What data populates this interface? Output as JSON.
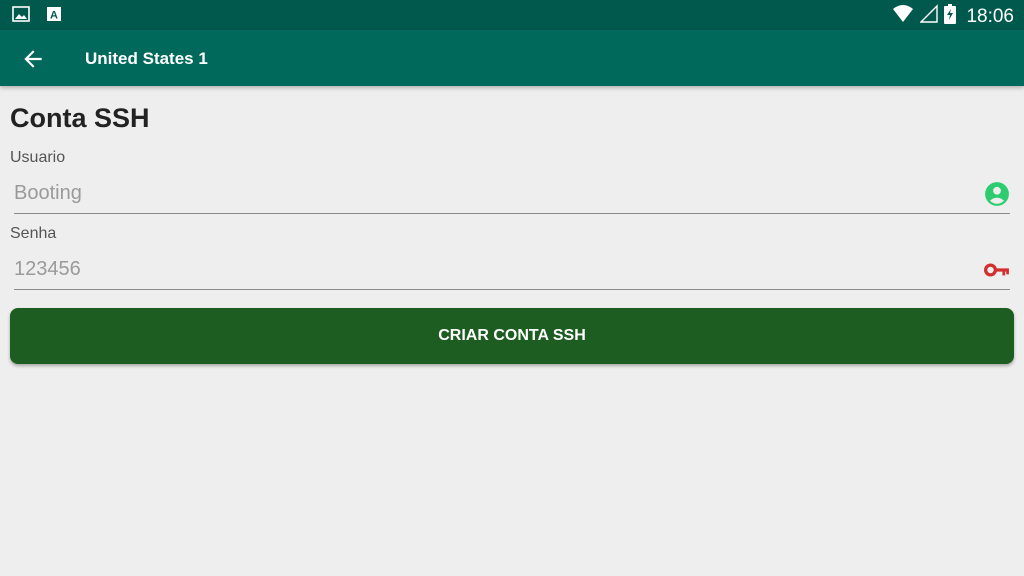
{
  "status_bar": {
    "time": "18:06",
    "left_icons": [
      "image-icon",
      "a-letter-icon"
    ],
    "right_icons": [
      "wifi-icon",
      "cell-signal-icon",
      "battery-charging-icon"
    ]
  },
  "toolbar": {
    "title": "United States 1",
    "back_icon": "arrow-left-icon",
    "color": "#00695c"
  },
  "page": {
    "title": "Conta SSH"
  },
  "form": {
    "username": {
      "label": "Usuario",
      "placeholder": "Booting",
      "value": "",
      "icon": "account-circle-icon",
      "icon_color": "#2ecc71"
    },
    "password": {
      "label": "Senha",
      "placeholder": "123456",
      "value": "",
      "icon": "key-icon",
      "icon_color": "#d32f2f"
    },
    "submit_label": "CRIAR CONTA SSH",
    "submit_color": "#1e5d22"
  }
}
